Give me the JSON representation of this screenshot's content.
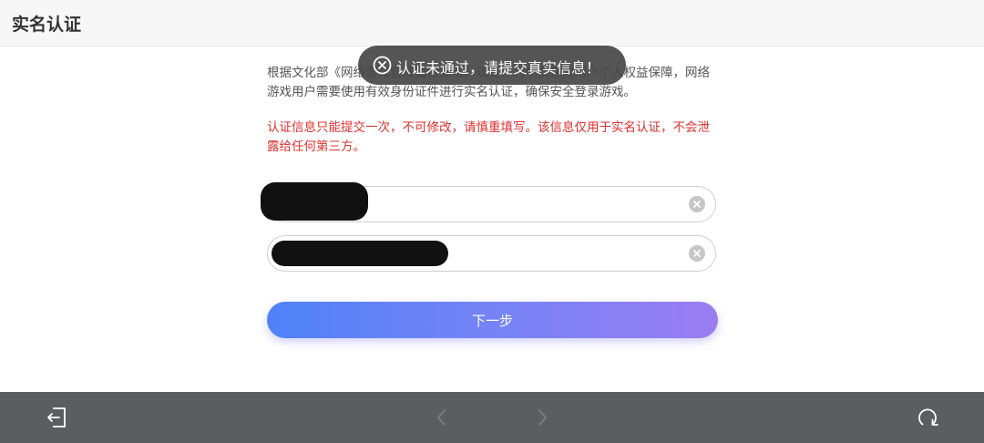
{
  "header": {
    "title": "实名认证"
  },
  "notice": {
    "text": "根据文化部《网络游戏管理暂行办法》规定，为切实保障用户个人权益保障，网络游戏用户需要使用有效身份证件进行实名认证，确保安全登录游戏。"
  },
  "warning": {
    "text": "认证信息只能提交一次，不可修改，请慎重填写。该信息仅用于实名认证，不会泄露给任何第三方。"
  },
  "form": {
    "name_value": "",
    "id_value": "",
    "next_label": "下一步"
  },
  "toast": {
    "text": "认证未通过，请提交真实信息！"
  },
  "icons": {
    "toast": "close-circle-icon",
    "clear": "clear-icon",
    "exit": "exit-icon",
    "back": "chevron-left-icon",
    "forward": "chevron-right-icon",
    "refresh": "refresh-icon"
  },
  "colors": {
    "warning": "#e03030",
    "button_start": "#4f82f7",
    "button_end": "#9a7cf2",
    "bottom_bar": "#5b5d60"
  }
}
